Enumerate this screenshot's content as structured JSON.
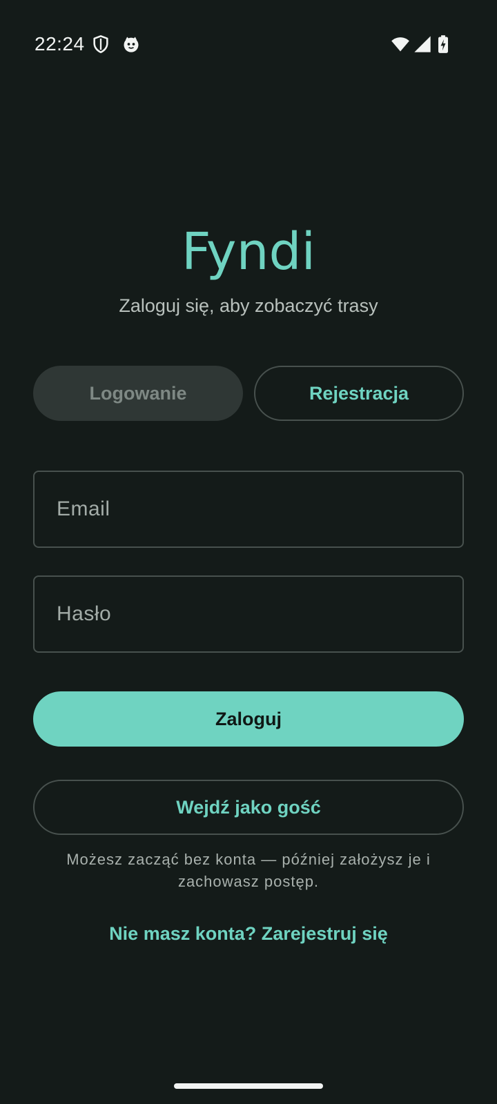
{
  "status_bar": {
    "time": "22:24",
    "left_icons": [
      "shield-icon",
      "cat-face-icon"
    ],
    "right_icons": [
      "wifi-icon",
      "signal-icon",
      "battery-charging-icon"
    ]
  },
  "header": {
    "title": "Fyndi",
    "subtitle": "Zaloguj się, aby zobaczyć trasy"
  },
  "tabs": [
    {
      "label": "Logowanie",
      "selected": true
    },
    {
      "label": "Rejestracja",
      "selected": false
    }
  ],
  "form": {
    "email": {
      "placeholder": "Email",
      "value": ""
    },
    "password": {
      "placeholder": "Hasło",
      "value": ""
    },
    "submit_label": "Zaloguj"
  },
  "guest": {
    "button_label": "Wejdź jako gość",
    "note": "Możesz zacząć bez konta — później założysz je i zachowasz postęp."
  },
  "footer": {
    "register_link": "Nie masz konta? Zarejestruj się"
  },
  "colors": {
    "background": "#141b19",
    "accent": "#6fd3c1",
    "selected_tab": "#2f3735",
    "outline": "#48514e"
  }
}
